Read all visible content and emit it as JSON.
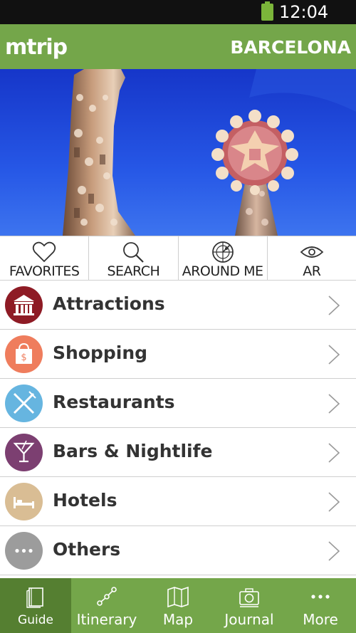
{
  "status_bar": {
    "time": "12:04 PM",
    "battery_icon": "battery-icon"
  },
  "header": {
    "logo": "mtrip",
    "city": "BARCELONA"
  },
  "hero": {
    "image": "sagrada-familia-spires-photo"
  },
  "quick_actions": [
    {
      "label": "FAVORITES",
      "icon": "heart-icon"
    },
    {
      "label": "SEARCH",
      "icon": "search-icon"
    },
    {
      "label": "AROUND ME",
      "icon": "radar-icon"
    },
    {
      "label": "AR",
      "icon": "eye-icon"
    }
  ],
  "categories": [
    {
      "label": "Attractions",
      "icon": "museum-icon",
      "color": "#8e1b25"
    },
    {
      "label": "Shopping",
      "icon": "shopping-bag-icon",
      "color": "#ef7d5d"
    },
    {
      "label": "Restaurants",
      "icon": "fork-knife-icon",
      "color": "#66b5e0"
    },
    {
      "label": "Bars & Nightlife",
      "icon": "cocktail-icon",
      "color": "#7c3f71"
    },
    {
      "label": "Hotels",
      "icon": "bed-icon",
      "color": "#d9bd94"
    },
    {
      "label": "Others",
      "icon": "ellipsis-icon",
      "color": "#9c9c9c"
    }
  ],
  "tabs": [
    {
      "label": "Guide",
      "icon": "book-icon",
      "active": true
    },
    {
      "label": "Itinerary",
      "icon": "route-icon",
      "active": false
    },
    {
      "label": "Map",
      "icon": "map-icon",
      "active": false
    },
    {
      "label": "Journal",
      "icon": "camera-icon",
      "active": false
    },
    {
      "label": "More",
      "icon": "more-dots-icon",
      "active": false
    }
  ],
  "colors": {
    "brand_green": "#74a64a",
    "brand_green_dark": "#557f31",
    "status_bar": "#111111",
    "sky_blue": "#1b3fd6"
  }
}
